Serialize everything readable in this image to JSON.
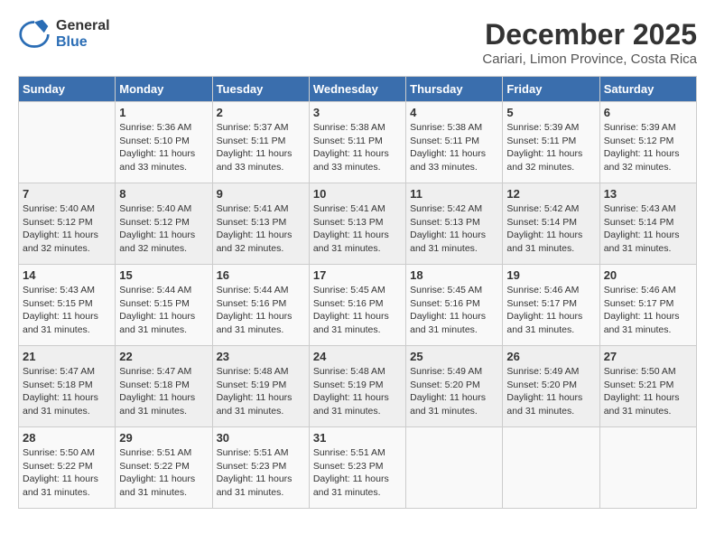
{
  "logo": {
    "general": "General",
    "blue": "Blue"
  },
  "title": "December 2025",
  "location": "Cariari, Limon Province, Costa Rica",
  "days_of_week": [
    "Sunday",
    "Monday",
    "Tuesday",
    "Wednesday",
    "Thursday",
    "Friday",
    "Saturday"
  ],
  "weeks": [
    [
      {
        "day": "",
        "info": ""
      },
      {
        "day": "1",
        "info": "Sunrise: 5:36 AM\nSunset: 5:10 PM\nDaylight: 11 hours\nand 33 minutes."
      },
      {
        "day": "2",
        "info": "Sunrise: 5:37 AM\nSunset: 5:11 PM\nDaylight: 11 hours\nand 33 minutes."
      },
      {
        "day": "3",
        "info": "Sunrise: 5:38 AM\nSunset: 5:11 PM\nDaylight: 11 hours\nand 33 minutes."
      },
      {
        "day": "4",
        "info": "Sunrise: 5:38 AM\nSunset: 5:11 PM\nDaylight: 11 hours\nand 33 minutes."
      },
      {
        "day": "5",
        "info": "Sunrise: 5:39 AM\nSunset: 5:11 PM\nDaylight: 11 hours\nand 32 minutes."
      },
      {
        "day": "6",
        "info": "Sunrise: 5:39 AM\nSunset: 5:12 PM\nDaylight: 11 hours\nand 32 minutes."
      }
    ],
    [
      {
        "day": "7",
        "info": "Sunrise: 5:40 AM\nSunset: 5:12 PM\nDaylight: 11 hours\nand 32 minutes."
      },
      {
        "day": "8",
        "info": "Sunrise: 5:40 AM\nSunset: 5:12 PM\nDaylight: 11 hours\nand 32 minutes."
      },
      {
        "day": "9",
        "info": "Sunrise: 5:41 AM\nSunset: 5:13 PM\nDaylight: 11 hours\nand 32 minutes."
      },
      {
        "day": "10",
        "info": "Sunrise: 5:41 AM\nSunset: 5:13 PM\nDaylight: 11 hours\nand 31 minutes."
      },
      {
        "day": "11",
        "info": "Sunrise: 5:42 AM\nSunset: 5:13 PM\nDaylight: 11 hours\nand 31 minutes."
      },
      {
        "day": "12",
        "info": "Sunrise: 5:42 AM\nSunset: 5:14 PM\nDaylight: 11 hours\nand 31 minutes."
      },
      {
        "day": "13",
        "info": "Sunrise: 5:43 AM\nSunset: 5:14 PM\nDaylight: 11 hours\nand 31 minutes."
      }
    ],
    [
      {
        "day": "14",
        "info": "Sunrise: 5:43 AM\nSunset: 5:15 PM\nDaylight: 11 hours\nand 31 minutes."
      },
      {
        "day": "15",
        "info": "Sunrise: 5:44 AM\nSunset: 5:15 PM\nDaylight: 11 hours\nand 31 minutes."
      },
      {
        "day": "16",
        "info": "Sunrise: 5:44 AM\nSunset: 5:16 PM\nDaylight: 11 hours\nand 31 minutes."
      },
      {
        "day": "17",
        "info": "Sunrise: 5:45 AM\nSunset: 5:16 PM\nDaylight: 11 hours\nand 31 minutes."
      },
      {
        "day": "18",
        "info": "Sunrise: 5:45 AM\nSunset: 5:16 PM\nDaylight: 11 hours\nand 31 minutes."
      },
      {
        "day": "19",
        "info": "Sunrise: 5:46 AM\nSunset: 5:17 PM\nDaylight: 11 hours\nand 31 minutes."
      },
      {
        "day": "20",
        "info": "Sunrise: 5:46 AM\nSunset: 5:17 PM\nDaylight: 11 hours\nand 31 minutes."
      }
    ],
    [
      {
        "day": "21",
        "info": "Sunrise: 5:47 AM\nSunset: 5:18 PM\nDaylight: 11 hours\nand 31 minutes."
      },
      {
        "day": "22",
        "info": "Sunrise: 5:47 AM\nSunset: 5:18 PM\nDaylight: 11 hours\nand 31 minutes."
      },
      {
        "day": "23",
        "info": "Sunrise: 5:48 AM\nSunset: 5:19 PM\nDaylight: 11 hours\nand 31 minutes."
      },
      {
        "day": "24",
        "info": "Sunrise: 5:48 AM\nSunset: 5:19 PM\nDaylight: 11 hours\nand 31 minutes."
      },
      {
        "day": "25",
        "info": "Sunrise: 5:49 AM\nSunset: 5:20 PM\nDaylight: 11 hours\nand 31 minutes."
      },
      {
        "day": "26",
        "info": "Sunrise: 5:49 AM\nSunset: 5:20 PM\nDaylight: 11 hours\nand 31 minutes."
      },
      {
        "day": "27",
        "info": "Sunrise: 5:50 AM\nSunset: 5:21 PM\nDaylight: 11 hours\nand 31 minutes."
      }
    ],
    [
      {
        "day": "28",
        "info": "Sunrise: 5:50 AM\nSunset: 5:22 PM\nDaylight: 11 hours\nand 31 minutes."
      },
      {
        "day": "29",
        "info": "Sunrise: 5:51 AM\nSunset: 5:22 PM\nDaylight: 11 hours\nand 31 minutes."
      },
      {
        "day": "30",
        "info": "Sunrise: 5:51 AM\nSunset: 5:23 PM\nDaylight: 11 hours\nand 31 minutes."
      },
      {
        "day": "31",
        "info": "Sunrise: 5:51 AM\nSunset: 5:23 PM\nDaylight: 11 hours\nand 31 minutes."
      },
      {
        "day": "",
        "info": ""
      },
      {
        "day": "",
        "info": ""
      },
      {
        "day": "",
        "info": ""
      }
    ]
  ]
}
